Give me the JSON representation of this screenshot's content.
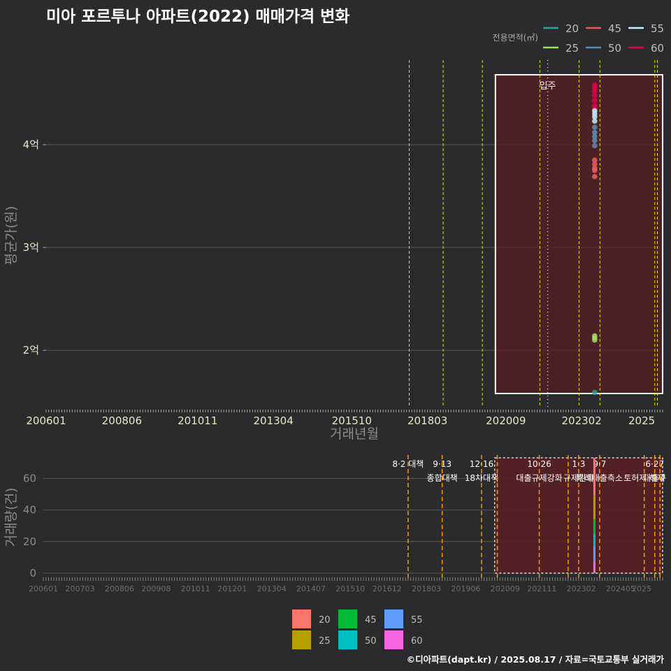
{
  "title": "미아 포르투나 아파트(2022) 매매가격 변화",
  "footer": "©디아파트(dapt.kr) / 2025.08.17 / 자료=국토교통부 실거래가",
  "colors": {
    "background": "#2b2b2d",
    "grid": "#5a5a5a",
    "policy_line": "#e6e600",
    "policy_line_bottom": "#ff9900",
    "period_fill": "#5a1e22",
    "period_border": "#ffffff"
  },
  "chart_data": [
    {
      "type": "scatter",
      "title": "미아 포르투나 아파트(2022) 매매가격 변화",
      "xlabel": "거래년월",
      "ylabel": "평균가(원)",
      "x_ticks": [
        "200601",
        "200806",
        "201011",
        "201304",
        "201510",
        "201803",
        "202009",
        "202302",
        "2025"
      ],
      "x_range": [
        "2006-01",
        "2025-09"
      ],
      "y_ticks": [
        "2억",
        "3억",
        "4억"
      ],
      "y_tick_values": [
        20000,
        30000,
        40000
      ],
      "y_unit": "만원",
      "ylim": [
        14500,
        48500
      ],
      "grid": true,
      "legend_title": "전용면적(㎡)",
      "legend_position": "top-right",
      "series": [
        {
          "name": "20",
          "color": "#2aa198"
        },
        {
          "name": "45",
          "color": "#ee5a5a"
        },
        {
          "name": "55",
          "color": "#bff0ff"
        },
        {
          "name": "25",
          "color": "#9be35a"
        },
        {
          "name": "50",
          "color": "#5b8fb5"
        },
        {
          "name": "60",
          "color": "#e8004a"
        }
      ],
      "highlight_period": {
        "start": "2020-05",
        "end": "2025-09"
      },
      "annotation": {
        "label": "입주",
        "x": "2022-01"
      },
      "policy_lines": [
        "2017-08",
        "2018-09",
        "2019-12",
        "2021-10",
        "2023-01",
        "2023-09",
        "2025-06",
        "2025-07"
      ],
      "points": [
        {
          "x": "2023-07",
          "y": 45800,
          "series": "60"
        },
        {
          "x": "2023-07",
          "y": 45500,
          "series": "60"
        },
        {
          "x": "2023-07",
          "y": 45200,
          "series": "60"
        },
        {
          "x": "2023-07",
          "y": 44800,
          "series": "60"
        },
        {
          "x": "2023-07",
          "y": 44300,
          "series": "60"
        },
        {
          "x": "2023-07",
          "y": 43800,
          "series": "60"
        },
        {
          "x": "2023-07",
          "y": 43500,
          "series": "60"
        },
        {
          "x": "2023-07",
          "y": 43300,
          "series": "55"
        },
        {
          "x": "2023-07",
          "y": 43000,
          "series": "55"
        },
        {
          "x": "2023-07",
          "y": 42700,
          "series": "55"
        },
        {
          "x": "2023-07",
          "y": 42300,
          "series": "55"
        },
        {
          "x": "2023-07",
          "y": 41700,
          "series": "50"
        },
        {
          "x": "2023-07",
          "y": 41200,
          "series": "50"
        },
        {
          "x": "2023-07",
          "y": 40800,
          "series": "50"
        },
        {
          "x": "2023-07",
          "y": 40400,
          "series": "50"
        },
        {
          "x": "2023-07",
          "y": 39900,
          "series": "50"
        },
        {
          "x": "2023-07",
          "y": 38500,
          "series": "45"
        },
        {
          "x": "2023-07",
          "y": 38100,
          "series": "45"
        },
        {
          "x": "2023-07",
          "y": 37700,
          "series": "45"
        },
        {
          "x": "2023-07",
          "y": 37500,
          "series": "45"
        },
        {
          "x": "2023-07",
          "y": 36900,
          "series": "45"
        },
        {
          "x": "2023-07",
          "y": 21400,
          "series": "25"
        },
        {
          "x": "2023-07",
          "y": 21200,
          "series": "25"
        },
        {
          "x": "2023-07",
          "y": 21000,
          "series": "25"
        },
        {
          "x": "2023-07",
          "y": 15900,
          "series": "20"
        }
      ]
    },
    {
      "type": "bar",
      "ylabel": "거래량(건)",
      "y_ticks": [
        0,
        20,
        40,
        60
      ],
      "ylim": [
        0,
        73
      ],
      "x_ticks": [
        "200601",
        "200703",
        "200806",
        "200908",
        "201011",
        "201201",
        "201304",
        "201407",
        "201510",
        "201612",
        "201803",
        "201906",
        "202009",
        "202111",
        "202302",
        "202405",
        "2025"
      ],
      "legend_position": "bottom",
      "series": [
        {
          "name": "20",
          "color": "#f8766d"
        },
        {
          "name": "25",
          "color": "#b79f00"
        },
        {
          "name": "45",
          "color": "#00ba38"
        },
        {
          "name": "50",
          "color": "#00bfc4"
        },
        {
          "name": "55",
          "color": "#619cff"
        },
        {
          "name": "60",
          "color": "#f564e3"
        }
      ],
      "highlight_period": {
        "start": "2020-05",
        "end": "2025-09"
      },
      "bars": [
        {
          "x": "2023-07",
          "stack": [
            {
              "series": "60",
              "value": 7
            },
            {
              "series": "55",
              "value": 10
            },
            {
              "series": "50",
              "value": 8
            },
            {
              "series": "45",
              "value": 9
            },
            {
              "series": "25",
              "value": 15
            },
            {
              "series": "20",
              "value": 24
            }
          ]
        }
      ],
      "policy_events": [
        {
          "x": "2017-08",
          "line1": "8·2 대책",
          "line2": ""
        },
        {
          "x": "2018-09",
          "line1": "9·13",
          "line2": "종합대책"
        },
        {
          "x": "2019-12",
          "line1": "12·16",
          "line2": "18차대책"
        },
        {
          "x": "2020-06",
          "line1": "",
          "line2": ""
        },
        {
          "x": "2021-10",
          "line1": "10·26",
          "line2": "대출규제강화"
        },
        {
          "x": "2022-09",
          "line1": "",
          "line2": ""
        },
        {
          "x": "2023-01",
          "line1": "1·3",
          "line2": "규제완화"
        },
        {
          "x": "2023-09",
          "line1": "9·7",
          "line2": "특례대출축소"
        },
        {
          "x": "2025-02",
          "line1": "",
          "line2": "토허제 해제"
        },
        {
          "x": "2025-06",
          "line1": "6·27",
          "line2": "대출규"
        },
        {
          "x": "2025-08",
          "line1": "",
          "line2": ""
        }
      ]
    }
  ]
}
